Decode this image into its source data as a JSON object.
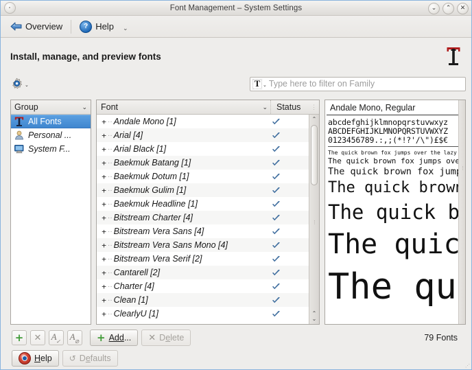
{
  "window": {
    "title": "Font Management – System Settings",
    "controls": {
      "menu_button": "window-menu",
      "shade": "⌄",
      "maximize": "⌃",
      "close": "✕"
    }
  },
  "toolbar": {
    "overview_label": "Overview",
    "help_label": "Help",
    "overflow_caret": "⌄"
  },
  "header": {
    "title": "Install, manage, and preview fonts",
    "module_icon": "font-module-icon"
  },
  "filter": {
    "settings_icon": "gear-icon",
    "settings_caret": "⌄",
    "type_icon": "T",
    "type_caret": "⌄",
    "placeholder": "Type here to filter on Family",
    "value": ""
  },
  "group_panel": {
    "header_label": "Group",
    "header_caret": "⌄",
    "items": [
      {
        "label": "All Fonts",
        "icon": "all-fonts-icon",
        "selected": true
      },
      {
        "label": "Personal ...",
        "icon": "personal-icon",
        "selected": false
      },
      {
        "label": "System F...",
        "icon": "system-fonts-icon",
        "selected": false
      }
    ]
  },
  "font_list": {
    "columns": {
      "font": "Font",
      "status": "Status"
    },
    "sort_caret": "⌄",
    "expander": "+",
    "status_icon": "check-icon",
    "rows": [
      {
        "name": "Andale Mono [1]",
        "status": "enabled"
      },
      {
        "name": "Arial [4]",
        "status": "enabled"
      },
      {
        "name": "Arial Black [1]",
        "status": "enabled"
      },
      {
        "name": "Baekmuk Batang [1]",
        "status": "enabled"
      },
      {
        "name": "Baekmuk Dotum [1]",
        "status": "enabled"
      },
      {
        "name": "Baekmuk Gulim [1]",
        "status": "enabled"
      },
      {
        "name": "Baekmuk Headline [1]",
        "status": "enabled"
      },
      {
        "name": "Bitstream Charter [4]",
        "status": "enabled"
      },
      {
        "name": "Bitstream Vera Sans [4]",
        "status": "enabled"
      },
      {
        "name": "Bitstream Vera Sans Mono [4]",
        "status": "enabled"
      },
      {
        "name": "Bitstream Vera Serif [2]",
        "status": "enabled"
      },
      {
        "name": "Cantarell [2]",
        "status": "enabled"
      },
      {
        "name": "Charter [4]",
        "status": "enabled"
      },
      {
        "name": "Clean [1]",
        "status": "enabled"
      },
      {
        "name": "ClearlyU [1]",
        "status": "enabled"
      }
    ],
    "scrollbar": {
      "up": "⌃",
      "down": "⌄"
    }
  },
  "preview": {
    "title": "Andale Mono, Regular",
    "charset": {
      "lower": "abcdefghijklmnopqrstuvwxyz",
      "upper": "ABCDEFGHIJKLMNOPQRSTUVWXYZ",
      "digits": "0123456789.:,;(*!?'/\\\")£$€"
    },
    "pangram": "The quick brown fox jumps over the lazy dog"
  },
  "actions": {
    "add_group": "+",
    "remove_group": "✕",
    "enable_fonts": "A",
    "disable_fonts": "A",
    "add_label": "Add...",
    "add_label_pre": "Add",
    "add_label_post": "...",
    "delete_label": "Delete",
    "delete_label_pre": "D",
    "delete_label_u": "e",
    "delete_label_post": "lete",
    "fonts_count": "79 Fonts"
  },
  "footer": {
    "help_label": "Help",
    "help_label_u": "H",
    "help_label_rest": "elp",
    "defaults_label": "Defaults",
    "defaults_label_pre": "D",
    "defaults_label_u": "e",
    "defaults_label_post": "faults"
  }
}
